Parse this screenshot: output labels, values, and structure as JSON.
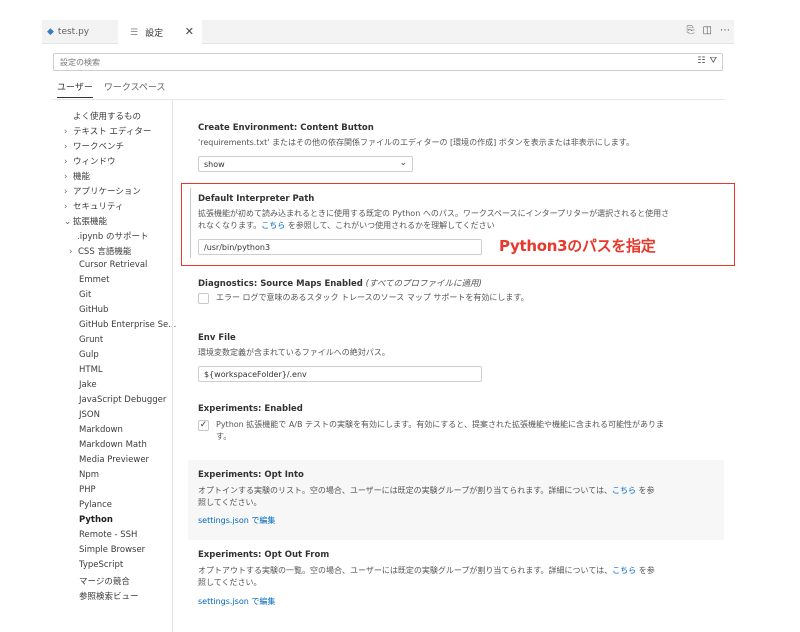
{
  "tabs": [
    {
      "label": "test.py"
    },
    {
      "label": "設定"
    }
  ],
  "search": {
    "placeholder": "設定の検索"
  },
  "scope_tabs": [
    "ユーザー",
    "ワークスペース"
  ],
  "sidebar": {
    "items": [
      {
        "label": "よく使用するもの"
      },
      {
        "label": "テキスト エディター"
      },
      {
        "label": "ワークベンチ"
      },
      {
        "label": "ウィンドウ"
      },
      {
        "label": "機能"
      },
      {
        "label": "アプリケーション"
      },
      {
        "label": "セキュリティ"
      },
      {
        "label": "拡張機能"
      },
      {
        "label": ".ipynb のサポート"
      },
      {
        "label": "CSS 言語機能"
      },
      {
        "label": "Cursor Retrieval"
      },
      {
        "label": "Emmet"
      },
      {
        "label": "Git"
      },
      {
        "label": "GitHub"
      },
      {
        "label": "GitHub Enterprise Se..."
      },
      {
        "label": "Grunt"
      },
      {
        "label": "Gulp"
      },
      {
        "label": "HTML"
      },
      {
        "label": "Jake"
      },
      {
        "label": "JavaScript Debugger"
      },
      {
        "label": "JSON"
      },
      {
        "label": "Markdown"
      },
      {
        "label": "Markdown Math"
      },
      {
        "label": "Media Previewer"
      },
      {
        "label": "Npm"
      },
      {
        "label": "PHP"
      },
      {
        "label": "Pylance"
      },
      {
        "label": "Python"
      },
      {
        "label": "Remote - SSH"
      },
      {
        "label": "Simple Browser"
      },
      {
        "label": "TypeScript"
      },
      {
        "label": "マージの競合"
      },
      {
        "label": "参照検索ビュー"
      }
    ]
  },
  "settings": {
    "create_env": {
      "category": "Create Environment: ",
      "name": "Content Button",
      "desc": "'requirements.txt' またはその他の依存関係ファイルのエディターの [環境の作成] ボタンを表示または非表示にします。",
      "value": "show"
    },
    "interpreter": {
      "name": "Default Interpreter Path",
      "desc1": "拡張機能が初めて読み込まれるときに使用する既定の Python へのパス。ワークスペースにインタープリターが選択されると使用さ",
      "desc2a": "れなくなります。",
      "desc2_link": "こちら",
      "desc2b": " を参照して、これがいつ使用されるかを理解してください",
      "value": "/usr/bin/python3",
      "annotation": "Python3のパスを指定"
    },
    "diagnostics": {
      "category": "Diagnostics: ",
      "name": "Source Maps Enabled",
      "scope": "(すべてのプロファイルに適用)",
      "desc": "エラー ログで意味のあるスタック トレースのソース マップ サポートを有効にします。"
    },
    "env_file": {
      "name": "Env File",
      "desc": "環境変数定義が含まれているファイルへの絶対パス。",
      "value": "${workspaceFolder}/.env"
    },
    "experiments_enabled": {
      "category": "Experiments: ",
      "name": "Enabled",
      "desc1": "Python 拡張機能で A/B テストの実験を有効にします。有効にすると、提案された拡張機能や機能に含まれる可能性がありま",
      "desc2": "す。"
    },
    "opt_into": {
      "category": "Experiments: ",
      "name": "Opt Into",
      "desc1a": "オプトインする実験のリスト。空の場合、ユーザーには既定の実験グループが割り当てられます。詳細については、",
      "desc1_link": "こちら",
      "desc1b": " を参",
      "desc2": "照してください。",
      "edit_link": "settings.json で編集"
    },
    "opt_out": {
      "category": "Experiments: ",
      "name": "Opt Out From",
      "desc1a": "オプトアウトする実験の一覧。空の場合、ユーザーには既定の実験グループが割り当てられます。詳細については、",
      "desc1_link": "こちら",
      "desc1b": " を参",
      "desc2": "照してください。",
      "edit_link": "settings.json で編集"
    }
  },
  "colors": {
    "accent_red": "#e8382c",
    "link": "#0066bf"
  }
}
